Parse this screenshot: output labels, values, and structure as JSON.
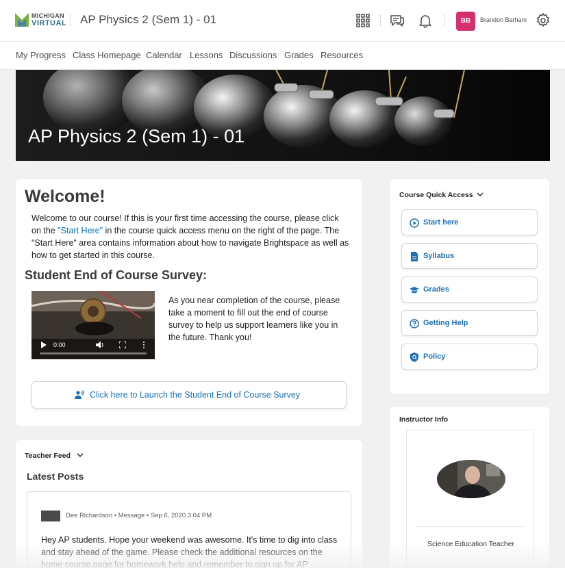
{
  "header": {
    "logo_line1": "MICHIGAN",
    "logo_line2": "VIRTUAL",
    "course_title": "AP Physics 2 (Sem 1) - 01",
    "user_initials": "BB",
    "user_name": "Brandon Barham",
    "icons": [
      "grid-icon",
      "chat-icon",
      "bell-icon",
      "gear-icon"
    ],
    "avatar_color": "#d4306e"
  },
  "nav": {
    "items": [
      "My Progress",
      "Class Homepage",
      "Calendar",
      "Lessons",
      "Discussions",
      "Grades",
      "Resources"
    ]
  },
  "banner": {
    "title": "AP Physics 2 (Sem 1) - 01"
  },
  "welcome": {
    "title": "Welcome!",
    "text_before_link": "Welcome to our course! If this is your first time accessing the course, please click on the ",
    "link_text": "\"Start Here\"",
    "text_after_link": " in the course quick access menu on the right of the page. The \"Start Here\" area contains information about how to navigate Brightspace as well as how to get started in this course.",
    "survey_title": "Student End of Course Survey:",
    "video_time": "0:00",
    "survey_text": "As you near completion of the course, please take a moment to fill out the end of course survey to help us support learners like you in the future. Thank you!",
    "launch_label": "Click here to Launch the Student End of Course Survey"
  },
  "quick_access": {
    "title": "Course Quick Access",
    "items": [
      {
        "label": "Start here",
        "icon": "play-circle-icon"
      },
      {
        "label": "Syllabus",
        "icon": "document-icon"
      },
      {
        "label": "Grades",
        "icon": "graduation-cap-icon"
      },
      {
        "label": "Getting Help",
        "icon": "help-circle-icon"
      },
      {
        "label": "Policy",
        "icon": "shield-icon"
      }
    ]
  },
  "feed": {
    "title": "Teacher Feed",
    "latest": "Latest Posts",
    "post_meta": "Dee Richardson • Message • Sep 6, 2020 3:04 PM",
    "post_body": "Hey AP students. Hope your weekend was awesome. It's time to dig into class and stay ahead of the game. Please check the additional resources on the home course page for homework help and remember to sign up for AP"
  },
  "instructor": {
    "title": "Instructor Info",
    "role": "Science Education Teacher"
  },
  "colors": {
    "link": "#006fbf",
    "accent_blue": "#1a6fb5"
  }
}
